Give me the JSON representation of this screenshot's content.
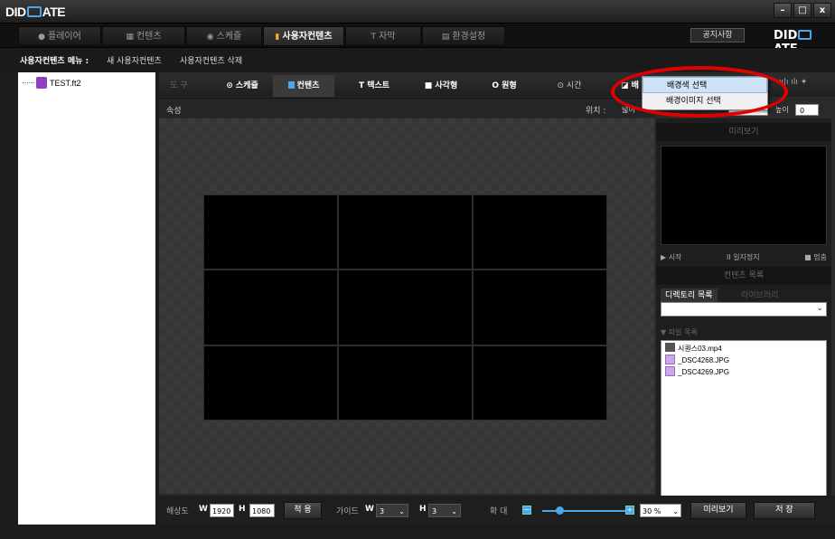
{
  "app": {
    "logo_left": "DID",
    "logo_right": "ATE",
    "window_buttons": [
      "–",
      "□",
      "x"
    ]
  },
  "tabs": [
    {
      "label": "플레이어",
      "icon": "●"
    },
    {
      "label": "컨텐츠",
      "icon": "▦"
    },
    {
      "label": "스케쥴",
      "icon": "◉"
    },
    {
      "label": "사용자컨텐츠",
      "icon": "▮",
      "active": true
    },
    {
      "label": "자막",
      "icon": "T"
    },
    {
      "label": "환경설정",
      "icon": "▤"
    }
  ],
  "header_right": {
    "notice": "공지사항",
    "logo_left": "DID",
    "logo_right": "ATE"
  },
  "menu": {
    "label": "사용자컨텐츠 메뉴 :",
    "new": "새 사용자컨텐츠",
    "delete": "사용자컨텐츠 삭제"
  },
  "tree": {
    "file": "TEST.ft2"
  },
  "toolbar": {
    "tool": "도 구",
    "schedule": "⊙ 스케쥴",
    "contents": "컨텐츠",
    "text": "T 텍스트",
    "rect": "■ 사각형",
    "circle": "O 원형",
    "time": "⊙ 시간",
    "bg": "◪ 배"
  },
  "props": {
    "label": "속성",
    "position": "위치 :",
    "width_label": "넓이",
    "height_label": "높이",
    "height_value": "0"
  },
  "context_menu": [
    "배경색 선택",
    "배경이미지 선택"
  ],
  "right": {
    "preview": "미리보기",
    "controls": [
      "▶ 시작",
      "II 일지정지",
      "■ 멈춤"
    ],
    "content_list": "컨텐츠 목록",
    "subtabs": [
      "디렉토리 목록",
      "라이브러리"
    ],
    "file_list": "▼ 파일 목록",
    "files": [
      "시퀀스03.mp4",
      "_DSC4268.JPG",
      "_DSC4269.JPG"
    ]
  },
  "bottom": {
    "res_label": "해상도",
    "w": "W",
    "w_value": "1920",
    "h": "H",
    "h_value": "1080",
    "apply": "적 용",
    "guide_label": "가이드",
    "gw": "W",
    "gw_value": "3",
    "gh": "H",
    "gh_value": "3",
    "zoom_label": "확 대",
    "zoom_value": "30 %",
    "preview": "미리보기",
    "save": "저 장"
  },
  "colors": {
    "accent": "#4aa8e8",
    "highlight_oval": "#e00000"
  }
}
